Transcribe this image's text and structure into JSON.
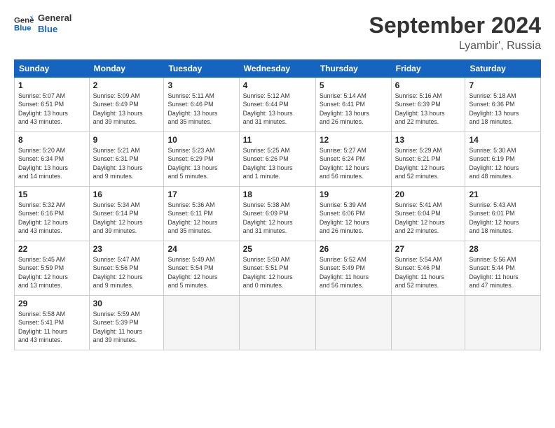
{
  "header": {
    "logo_line1": "General",
    "logo_line2": "Blue",
    "month": "September 2024",
    "location": "Lyambir', Russia"
  },
  "weekdays": [
    "Sunday",
    "Monday",
    "Tuesday",
    "Wednesday",
    "Thursday",
    "Friday",
    "Saturday"
  ],
  "weeks": [
    [
      {
        "day": "1",
        "info": "Sunrise: 5:07 AM\nSunset: 6:51 PM\nDaylight: 13 hours\nand 43 minutes."
      },
      {
        "day": "2",
        "info": "Sunrise: 5:09 AM\nSunset: 6:49 PM\nDaylight: 13 hours\nand 39 minutes."
      },
      {
        "day": "3",
        "info": "Sunrise: 5:11 AM\nSunset: 6:46 PM\nDaylight: 13 hours\nand 35 minutes."
      },
      {
        "day": "4",
        "info": "Sunrise: 5:12 AM\nSunset: 6:44 PM\nDaylight: 13 hours\nand 31 minutes."
      },
      {
        "day": "5",
        "info": "Sunrise: 5:14 AM\nSunset: 6:41 PM\nDaylight: 13 hours\nand 26 minutes."
      },
      {
        "day": "6",
        "info": "Sunrise: 5:16 AM\nSunset: 6:39 PM\nDaylight: 13 hours\nand 22 minutes."
      },
      {
        "day": "7",
        "info": "Sunrise: 5:18 AM\nSunset: 6:36 PM\nDaylight: 13 hours\nand 18 minutes."
      }
    ],
    [
      {
        "day": "8",
        "info": "Sunrise: 5:20 AM\nSunset: 6:34 PM\nDaylight: 13 hours\nand 14 minutes."
      },
      {
        "day": "9",
        "info": "Sunrise: 5:21 AM\nSunset: 6:31 PM\nDaylight: 13 hours\nand 9 minutes."
      },
      {
        "day": "10",
        "info": "Sunrise: 5:23 AM\nSunset: 6:29 PM\nDaylight: 13 hours\nand 5 minutes."
      },
      {
        "day": "11",
        "info": "Sunrise: 5:25 AM\nSunset: 6:26 PM\nDaylight: 13 hours\nand 1 minute."
      },
      {
        "day": "12",
        "info": "Sunrise: 5:27 AM\nSunset: 6:24 PM\nDaylight: 12 hours\nand 56 minutes."
      },
      {
        "day": "13",
        "info": "Sunrise: 5:29 AM\nSunset: 6:21 PM\nDaylight: 12 hours\nand 52 minutes."
      },
      {
        "day": "14",
        "info": "Sunrise: 5:30 AM\nSunset: 6:19 PM\nDaylight: 12 hours\nand 48 minutes."
      }
    ],
    [
      {
        "day": "15",
        "info": "Sunrise: 5:32 AM\nSunset: 6:16 PM\nDaylight: 12 hours\nand 43 minutes."
      },
      {
        "day": "16",
        "info": "Sunrise: 5:34 AM\nSunset: 6:14 PM\nDaylight: 12 hours\nand 39 minutes."
      },
      {
        "day": "17",
        "info": "Sunrise: 5:36 AM\nSunset: 6:11 PM\nDaylight: 12 hours\nand 35 minutes."
      },
      {
        "day": "18",
        "info": "Sunrise: 5:38 AM\nSunset: 6:09 PM\nDaylight: 12 hours\nand 31 minutes."
      },
      {
        "day": "19",
        "info": "Sunrise: 5:39 AM\nSunset: 6:06 PM\nDaylight: 12 hours\nand 26 minutes."
      },
      {
        "day": "20",
        "info": "Sunrise: 5:41 AM\nSunset: 6:04 PM\nDaylight: 12 hours\nand 22 minutes."
      },
      {
        "day": "21",
        "info": "Sunrise: 5:43 AM\nSunset: 6:01 PM\nDaylight: 12 hours\nand 18 minutes."
      }
    ],
    [
      {
        "day": "22",
        "info": "Sunrise: 5:45 AM\nSunset: 5:59 PM\nDaylight: 12 hours\nand 13 minutes."
      },
      {
        "day": "23",
        "info": "Sunrise: 5:47 AM\nSunset: 5:56 PM\nDaylight: 12 hours\nand 9 minutes."
      },
      {
        "day": "24",
        "info": "Sunrise: 5:49 AM\nSunset: 5:54 PM\nDaylight: 12 hours\nand 5 minutes."
      },
      {
        "day": "25",
        "info": "Sunrise: 5:50 AM\nSunset: 5:51 PM\nDaylight: 12 hours\nand 0 minutes."
      },
      {
        "day": "26",
        "info": "Sunrise: 5:52 AM\nSunset: 5:49 PM\nDaylight: 11 hours\nand 56 minutes."
      },
      {
        "day": "27",
        "info": "Sunrise: 5:54 AM\nSunset: 5:46 PM\nDaylight: 11 hours\nand 52 minutes."
      },
      {
        "day": "28",
        "info": "Sunrise: 5:56 AM\nSunset: 5:44 PM\nDaylight: 11 hours\nand 47 minutes."
      }
    ],
    [
      {
        "day": "29",
        "info": "Sunrise: 5:58 AM\nSunset: 5:41 PM\nDaylight: 11 hours\nand 43 minutes."
      },
      {
        "day": "30",
        "info": "Sunrise: 5:59 AM\nSunset: 5:39 PM\nDaylight: 11 hours\nand 39 minutes."
      },
      {
        "day": "",
        "info": ""
      },
      {
        "day": "",
        "info": ""
      },
      {
        "day": "",
        "info": ""
      },
      {
        "day": "",
        "info": ""
      },
      {
        "day": "",
        "info": ""
      }
    ]
  ]
}
